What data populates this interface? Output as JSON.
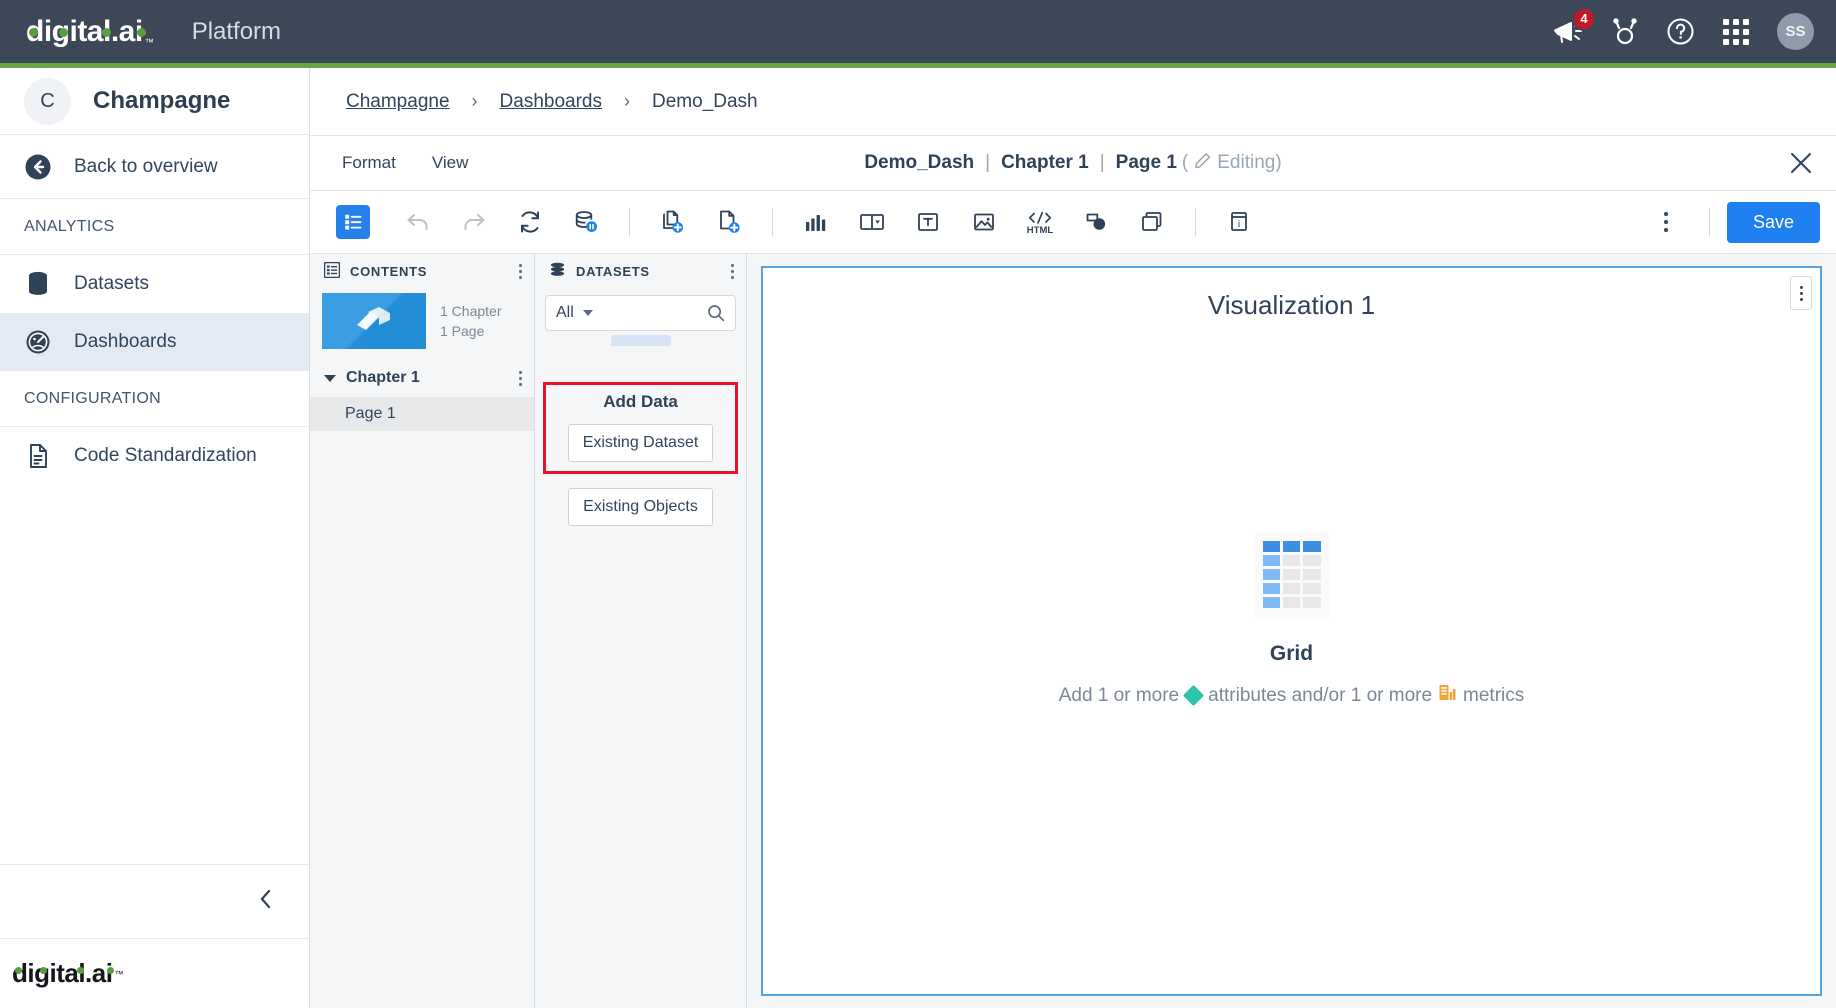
{
  "topbar": {
    "logo": "digital.ai",
    "logo_tm": "™",
    "platform": "Platform",
    "notification_count": "4",
    "icons": [
      "megaphone-icon",
      "trophy-icon",
      "help-icon",
      "apps-grid-icon"
    ],
    "avatar_initials": "SS"
  },
  "sidebar": {
    "project_initial": "C",
    "project_name": "Champagne",
    "back_label": "Back to overview",
    "sections": [
      {
        "label": "ANALYTICS"
      },
      {
        "label": "CONFIGURATION"
      }
    ],
    "analytics_items": [
      {
        "label": "Datasets",
        "icon": "database-icon",
        "active": false
      },
      {
        "label": "Dashboards",
        "icon": "gauge-icon",
        "active": true
      }
    ],
    "configuration_items": [
      {
        "label": "Code Standardization",
        "icon": "document-icon"
      }
    ],
    "footer_logo": "digital.ai",
    "footer_logo_tm": "™"
  },
  "breadcrumb": {
    "item1": "Champagne",
    "sep1": "›",
    "item2": "Dashboards",
    "sep2": "›",
    "item3": "Demo_Dash"
  },
  "editbar": {
    "menu": [
      "Format",
      "View"
    ],
    "menu_format": "Format",
    "menu_view": "View",
    "title_doc": "Demo_Dash",
    "title_chapter": "Chapter 1",
    "title_page": "Page 1",
    "editing_open": "(",
    "editing_label": "Editing)",
    "pipe": "|"
  },
  "toolbar": {
    "items": [
      {
        "name": "panels-toggle-icon",
        "label": "Panels"
      },
      {
        "name": "undo-icon",
        "label": "Undo"
      },
      {
        "name": "redo-icon",
        "label": "Redo"
      },
      {
        "name": "refresh-icon",
        "label": "Refresh"
      },
      {
        "name": "dataset-pause-icon",
        "label": "Dataset"
      },
      {
        "name": "add-chapter-icon",
        "label": "Insert Chapter"
      },
      {
        "name": "add-page-icon",
        "label": "Insert Page"
      },
      {
        "name": "chart-icon",
        "label": "Insert Visualization"
      },
      {
        "name": "panel-stack-icon",
        "label": "Insert Panel Stack"
      },
      {
        "name": "text-icon",
        "label": "Insert Text"
      },
      {
        "name": "image-icon",
        "label": "Insert Image"
      },
      {
        "name": "html-icon",
        "label": "Insert HTML Container"
      },
      {
        "name": "shape-icon",
        "label": "Insert Shape"
      },
      {
        "name": "duplicate-icon",
        "label": "Duplicate"
      },
      {
        "name": "info-icon",
        "label": "Info Window"
      }
    ],
    "html_label": "HTML",
    "more_label": "More options",
    "save_label": "Save"
  },
  "contents_panel": {
    "title": "CONTENTS",
    "card_line1": "1 Chapter",
    "card_line2": "1 Page",
    "chapter_label": "Chapter 1",
    "page_label": "Page 1"
  },
  "datasets_panel": {
    "title": "DATASETS",
    "filter_value": "All",
    "search_placeholder": "Search",
    "add_data_title": "Add Data",
    "existing_dataset_label": "Existing Dataset",
    "existing_objects_label": "Existing Objects",
    "highlight_color": "#e8112d"
  },
  "visualization": {
    "title": "Visualization 1",
    "type_label": "Grid",
    "hint_prefix": "Add 1 or more",
    "hint_attributes": "attributes and/or 1 or more",
    "hint_metrics": "metrics",
    "attribute_color": "#2fc4a7",
    "metric_color": "#f2a33c",
    "border_color": "#56a2de"
  }
}
